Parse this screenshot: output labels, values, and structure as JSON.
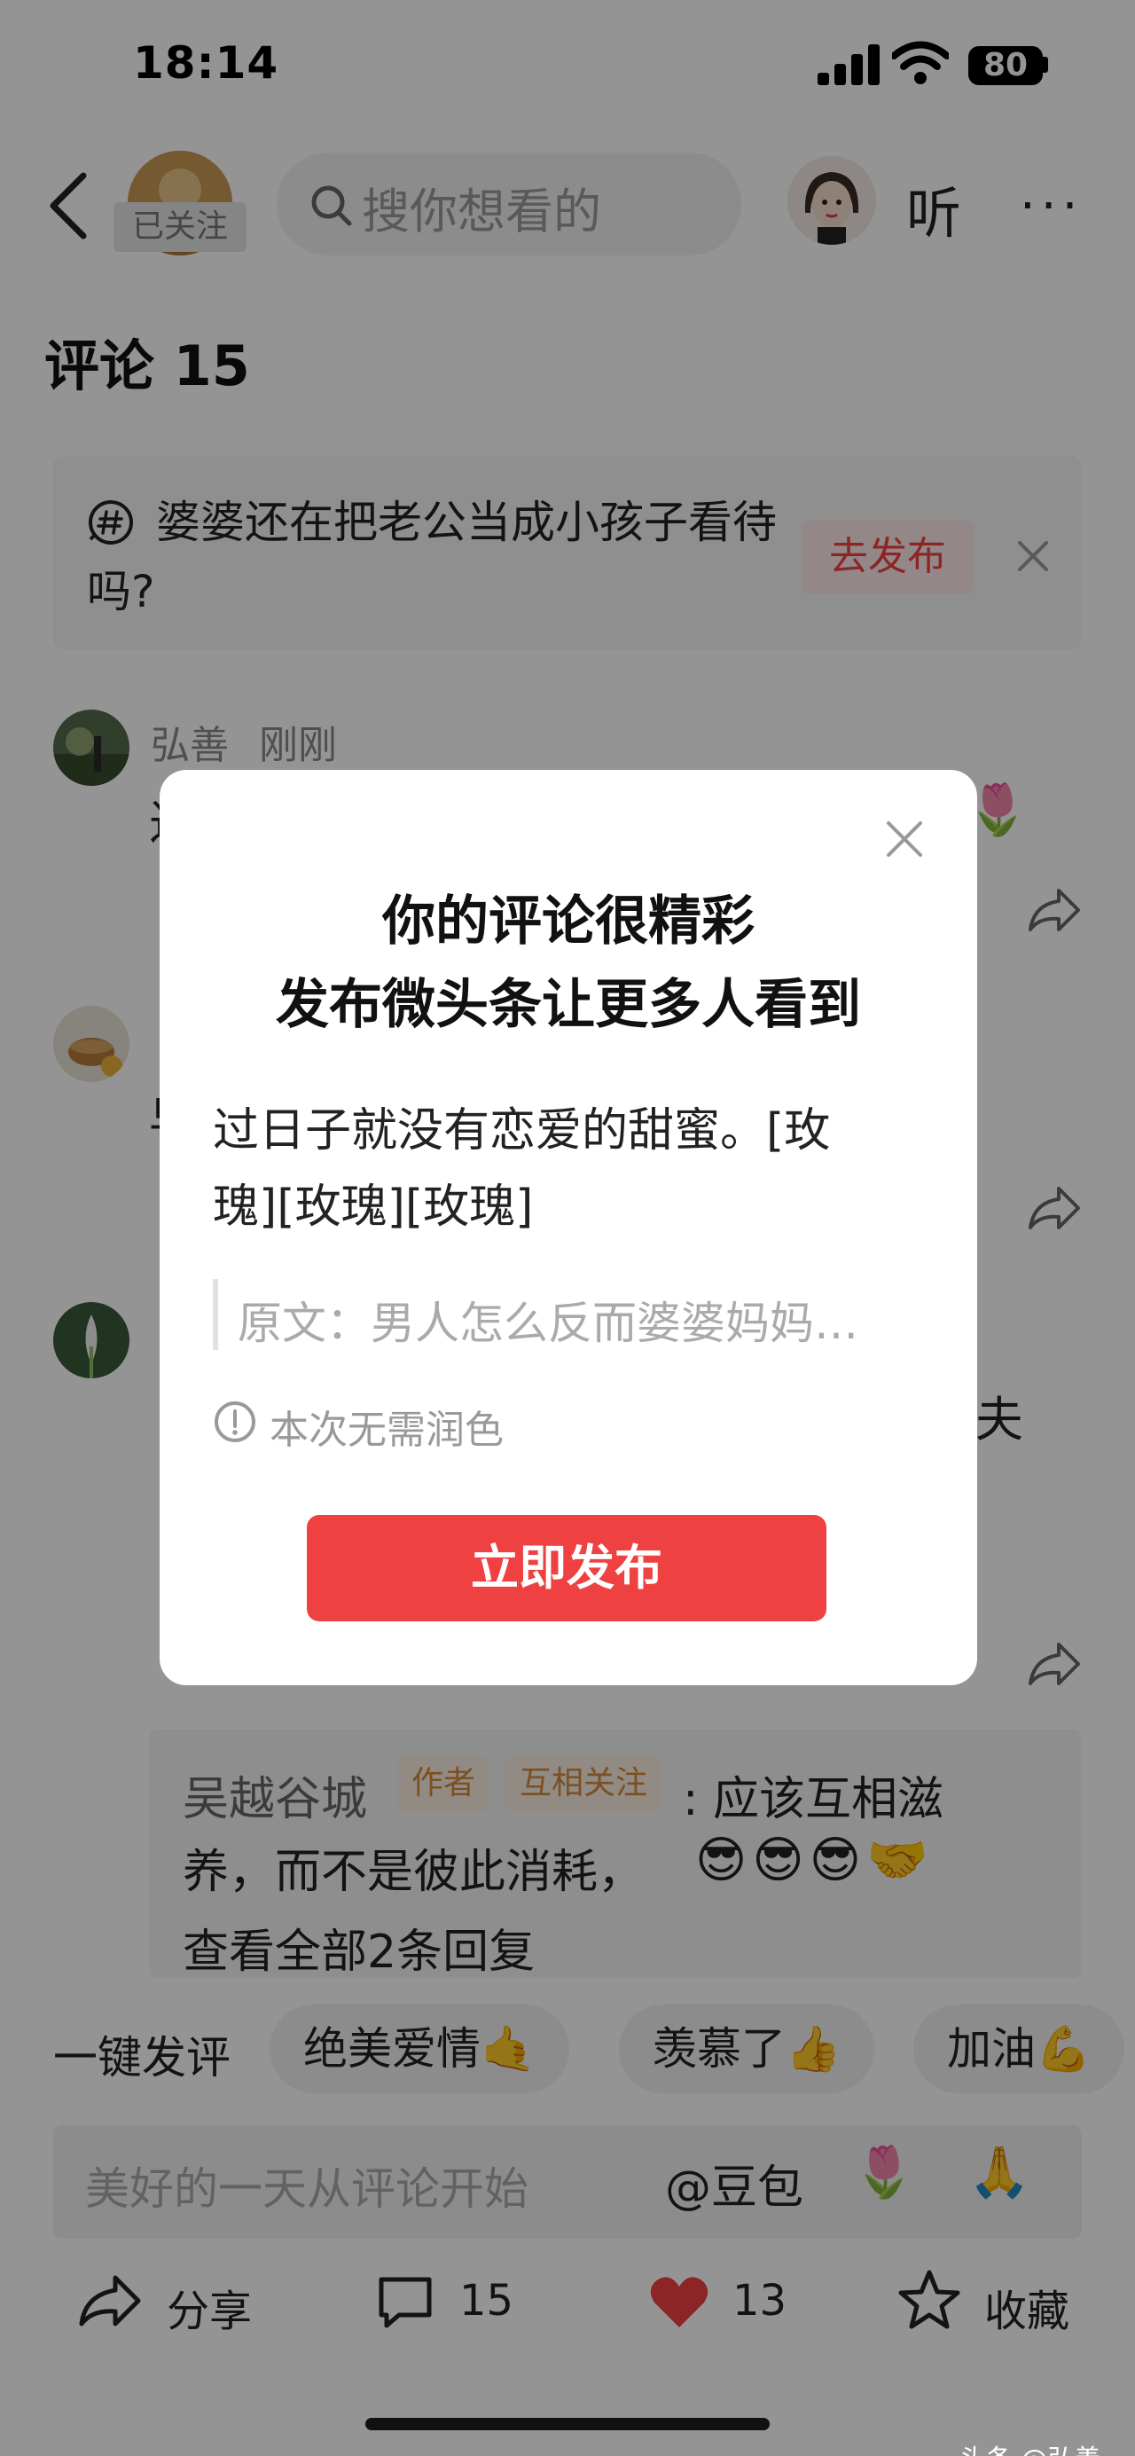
{
  "status_bar": {
    "time": "18:14",
    "battery": "80"
  },
  "header": {
    "follow_label": "已关注",
    "search_placeholder": "搜你想看的",
    "listen_label": "听",
    "more_label": "···"
  },
  "comments_header": {
    "label": "评论 15"
  },
  "prompt_card": {
    "question": "婆婆还在把老公当成小孩子看待吗?",
    "action_label": "去发布"
  },
  "comments": [
    {
      "name": "弘善",
      "time": "刚刚"
    }
  ],
  "reply": {
    "author": "吴越谷城",
    "badges": [
      "作者",
      "互相关注"
    ],
    "text_line1": ": 应该互相滋",
    "text_line2": "养，而不是彼此消耗，",
    "emojis": "😎😎😎🤝",
    "view_all": "查看全部2条回复"
  },
  "quick_comments": {
    "label": "一键发评",
    "chips": [
      "绝美爱情🤙",
      "羡慕了👍",
      "加油💪"
    ]
  },
  "comment_input": {
    "placeholder": "美好的一天从评论开始",
    "doubao_label": "@豆包",
    "emoji_1": "🌷",
    "emoji_2": "🙏"
  },
  "bottom_bar": {
    "share_label": "分享",
    "comment_count": "15",
    "like_count": "13",
    "favorite_label": "收藏"
  },
  "watermark": "头条 @弘善",
  "modal": {
    "title_line1": "你的评论很精彩",
    "title_line2": "发布微头条让更多人看到",
    "body": "过日子就没有恋爱的甜蜜。[玫瑰][玫瑰][玫瑰]",
    "quote": "原文：男人怎么反而婆婆妈妈…",
    "info": "本次无需润色",
    "publish_label": "立即发布"
  },
  "colors": {
    "accent_red": "#f04142",
    "badge_bg": "#fbefe2",
    "badge_text": "#d58a3b",
    "overlay": "rgba(0,0,0,0.42)"
  }
}
